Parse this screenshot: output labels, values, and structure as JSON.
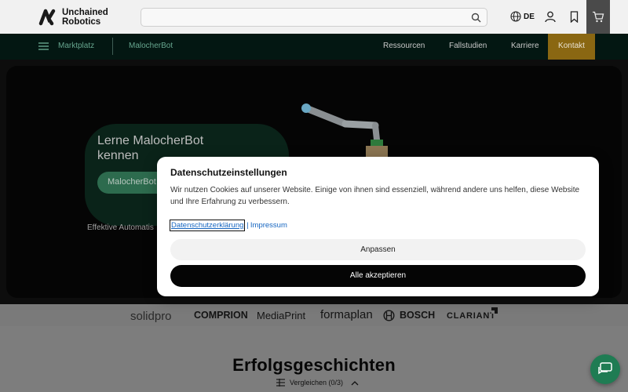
{
  "header": {
    "logo_line1": "Unchained",
    "logo_line2": "Robotics",
    "search_placeholder": "",
    "language": "DE"
  },
  "nav": {
    "menu_label": "Marktplatz",
    "product_label": "MalocherBot",
    "right_items": [
      "Ressourcen",
      "Fallstudien",
      "Karriere"
    ],
    "contact_label": "Kontakt"
  },
  "hero": {
    "title_line1": "Lerne MalocherBot",
    "title_line2": "kennen",
    "button_label": "MalocherBot",
    "subtitle": "Effektive Automatis"
  },
  "brands": [
    "solidpro",
    "COMPRION",
    "MediaPrint",
    "formaplan",
    "BOSCH",
    "CLARIANT"
  ],
  "section": {
    "title": "Erfolgsgeschichten",
    "compare_label": "Vergleichen (0/3)"
  },
  "cookie_dialog": {
    "title": "Datenschutzeinstellungen",
    "text": "Wir nutzen Cookies auf unserer Website. Einige von ihnen sind essenziell, während andere uns helfen, diese Website und Ihre Erfahrung zu verbessern.",
    "privacy_link": "Datenschutzerklärung",
    "separator": "|",
    "imprint_link": "Impressum",
    "customize_label": "Anpassen",
    "accept_all_label": "Alle akzeptieren"
  },
  "colors": {
    "accent_green": "#2d6b4e",
    "nav_bg": "#031712",
    "contact_bg": "#8a6712",
    "chat_green": "#1f7c53"
  }
}
